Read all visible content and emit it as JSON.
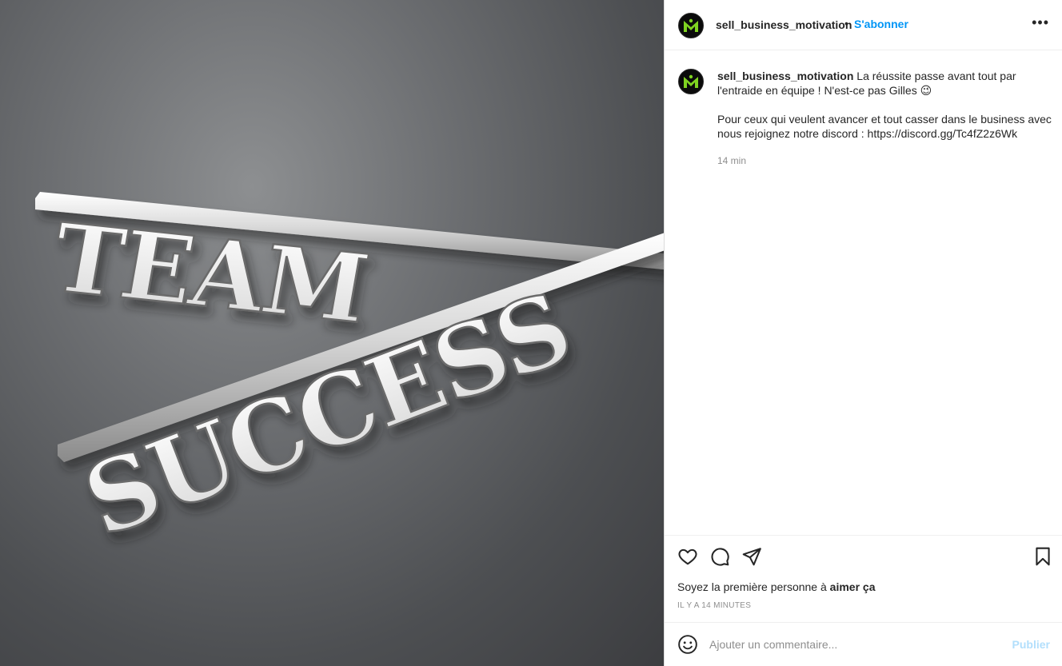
{
  "post": {
    "username": "sell_business_motivation",
    "follow_separator": "•",
    "follow_label": "S'abonner",
    "more_label": "•••",
    "image_words": [
      "TEAM",
      "SUCCESS"
    ]
  },
  "caption": {
    "username": "sell_business_motivation",
    "line1": " La réussite passe avant tout par l'entraide en équipe ! N'est-ce pas Gilles 😉",
    "line2": "Pour ceux qui veulent avancer et tout casser dans le business avec nous rejoignez notre discord : https://discord.gg/Tc4fZ2z6Wk",
    "time": "14 min"
  },
  "actions": {
    "icons": [
      "heart-icon",
      "comment-icon",
      "share-icon",
      "bookmark-icon"
    ],
    "likes_prefix": "Soyez la première personne à ",
    "likes_bold": "aimer ça",
    "posted_ago": "IL Y A 14 MINUTES"
  },
  "comment": {
    "placeholder": "Ajouter un commentaire...",
    "publish_label": "Publier"
  },
  "colors": {
    "accent": "#0095f6",
    "publish_disabled": "#b2dffc",
    "logo_green": "#7fd321"
  }
}
